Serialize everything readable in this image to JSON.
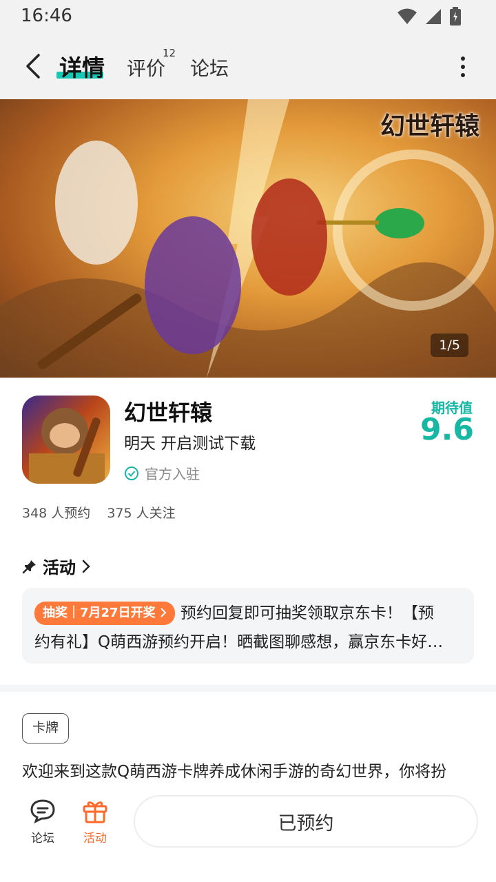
{
  "status_bar": {
    "time": "16:46"
  },
  "nav": {
    "tabs": [
      {
        "label": "详情",
        "active": true
      },
      {
        "label": "评价",
        "badge": "12"
      },
      {
        "label": "论坛"
      }
    ],
    "accent_color": "#16c8b4"
  },
  "banner": {
    "logo_text": "幻世轩辕",
    "counter": "1/5"
  },
  "app": {
    "title": "幻世轩辕",
    "subtitle": "明天 开启测试下载",
    "official_label": "官方入驻",
    "rating_label": "期待值",
    "rating_value": "9.6"
  },
  "stats": {
    "reservations": "348 人预约",
    "followers": "375 人关注"
  },
  "activity": {
    "header": "活动",
    "tag": "抽奖｜7月27日开奖",
    "text_line1": "预约回复即可抽奖领取京东卡！【预",
    "text_line2": "约有礼】Q萌西游预约开启！晒截图聊感想，赢京东卡好…"
  },
  "genre_tag": "卡牌",
  "description": "欢迎来到这款Q萌西游卡牌养成休闲手游的奇幻世界，你将扮",
  "bottom": {
    "forum_label": "论坛",
    "activity_label": "活动",
    "reserve_label": "已预约"
  }
}
